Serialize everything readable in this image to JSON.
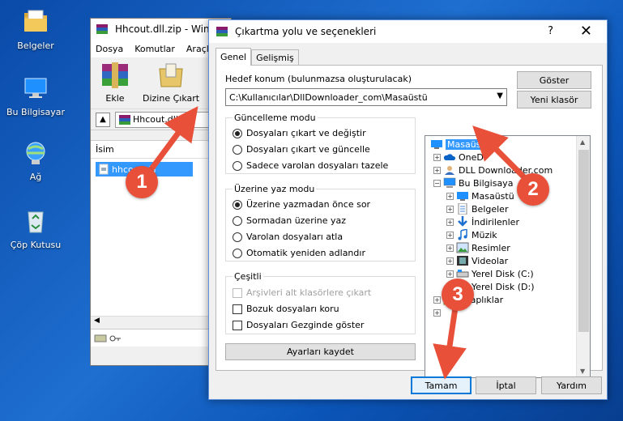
{
  "desktop": {
    "icons": [
      {
        "label": "Belgeler",
        "icon": "documents-folder-icon"
      },
      {
        "label": "Bu Bilgisayar",
        "icon": "computer-icon"
      },
      {
        "label": "Ağ",
        "icon": "network-icon"
      },
      {
        "label": "Çöp Kutusu",
        "icon": "recycle-bin-icon"
      }
    ]
  },
  "winrar": {
    "title": "Hhcout.dll.zip - WinR",
    "menu": [
      "Dosya",
      "Komutlar",
      "Araçla"
    ],
    "toolbar": {
      "add_label": "Ekle",
      "extract_label": "Dizine Çıkart"
    },
    "path": "Hhcout.dll.zi",
    "list_header": "İsim",
    "list_item": "hhcout.dll"
  },
  "dialog": {
    "title": "Çıkartma yolu ve seçenekleri",
    "help": "?",
    "close": "✕",
    "tabs": [
      "Genel",
      "Gelişmiş"
    ],
    "dest_label": "Hedef konum (bulunmazsa oluşturulacak)",
    "dest_value": "C:\\Kullanıcılar\\DllDownloader_com\\Masaüstü",
    "show_button": "Göster",
    "new_folder_button": "Yeni klasör",
    "update_mode": {
      "title": "Güncelleme modu",
      "options": [
        "Dosyaları çıkart ve değiştir",
        "Dosyaları çıkart ve güncelle",
        "Sadece varolan dosyaları tazele"
      ],
      "selected": 0
    },
    "overwrite_mode": {
      "title": "Üzerine yaz modu",
      "options": [
        "Üzerine yazmadan önce sor",
        "Sormadan üzerine yaz",
        "Varolan dosyaları atla",
        "Otomatik yeniden adlandır"
      ],
      "selected": 0
    },
    "misc": {
      "title": "Çeşitli",
      "options": [
        "Arşivleri alt klasörlere çıkart",
        "Bozuk dosyaları koru",
        "Dosyaları Gezginde göster"
      ]
    },
    "save_settings_button": "Ayarları kaydet",
    "tree": [
      {
        "label": "Masaüstü",
        "selected": true
      },
      {
        "label": "OneD"
      },
      {
        "label": "DLL Downloader.com"
      },
      {
        "label": "Bu Bilgisaya"
      },
      {
        "label": "Masaüstü"
      },
      {
        "label": "Belgeler"
      },
      {
        "label": "İndirilenler"
      },
      {
        "label": "Müzik"
      },
      {
        "label": "Resimler"
      },
      {
        "label": "Videolar"
      },
      {
        "label": "Yerel Disk (C:)"
      },
      {
        "label": "Yerel Disk (D:)"
      },
      {
        "label": "Kitaplıklar"
      }
    ],
    "ok_button": "Tamam",
    "cancel_button": "İptal",
    "help_button": "Yardım"
  },
  "annotations": [
    "1",
    "2",
    "3"
  ],
  "colors": {
    "accent": "#0078d7",
    "selection": "#3399ff",
    "badge": "#e8503a"
  }
}
